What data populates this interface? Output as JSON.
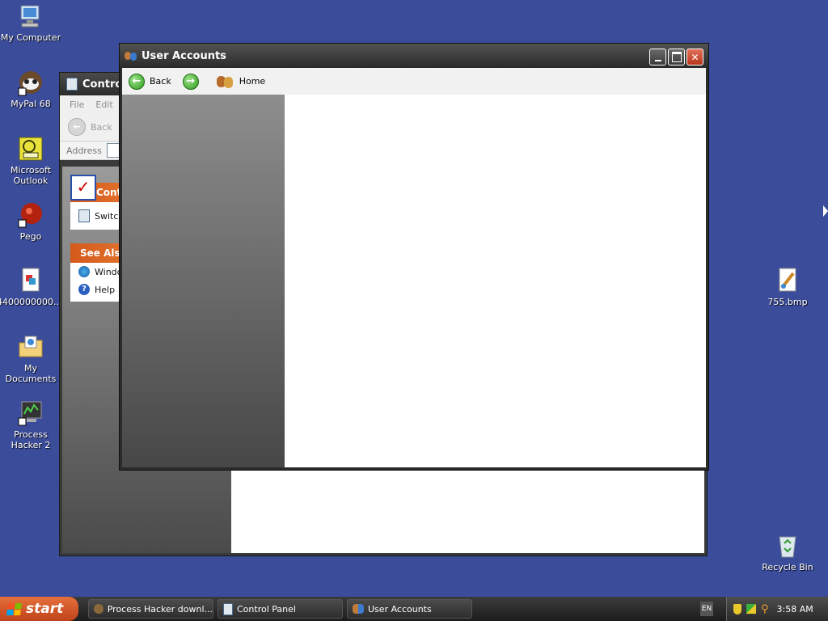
{
  "desktop": {
    "icons": [
      {
        "label": "My Computer",
        "icon": "my-computer-icon"
      },
      {
        "label": "MyPal 68",
        "icon": "mypal-icon"
      },
      {
        "label": "Microsoft Outlook",
        "icon": "outlook-icon"
      },
      {
        "label": "Pego",
        "icon": "pego-icon"
      },
      {
        "label": "4400000000....",
        "icon": "image-file-icon"
      },
      {
        "label": "My Documents",
        "icon": "my-documents-icon"
      },
      {
        "label": "Process Hacker 2",
        "icon": "process-hacker-icon"
      },
      {
        "label": "755.bmp",
        "icon": "bitmap-file-icon"
      },
      {
        "label": "Recycle Bin",
        "icon": "recycle-bin-icon"
      }
    ]
  },
  "control_panel": {
    "title": "Control",
    "menu": [
      "File",
      "Edit"
    ],
    "back_label": "Back",
    "address_label": "Address",
    "panel1_head": "Cont",
    "panel1_item": "Switc",
    "panel2_head": "See Also",
    "panel2_items": [
      "Windc",
      "Help"
    ]
  },
  "user_accounts": {
    "title": "User Accounts",
    "back_label": "Back",
    "home_label": "Home"
  },
  "taskbar": {
    "start_label": "start",
    "tasks": [
      "Process Hacker downl...",
      "Control Panel",
      "User Accounts"
    ],
    "lang": "EN",
    "clock": "3:58 AM"
  },
  "colors": {
    "desktop": "#3b4c9b",
    "accent_orange": "#d45a1c"
  }
}
